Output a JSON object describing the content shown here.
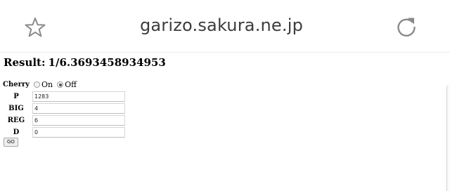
{
  "browser": {
    "url": "garizo.sakura.ne.jp",
    "star_icon": "star-outline-icon",
    "reload_icon": "reload-icon"
  },
  "result": {
    "label": "Result:",
    "value": "1/6.3693458934953"
  },
  "form": {
    "cherry": {
      "label": "Cherry",
      "options": [
        {
          "label": "On",
          "checked": false
        },
        {
          "label": "Off",
          "checked": true
        }
      ]
    },
    "fields": [
      {
        "label": "P",
        "value": "1283"
      },
      {
        "label": "BIG",
        "value": "4"
      },
      {
        "label": "REG",
        "value": "6"
      },
      {
        "label": "D",
        "value": "0"
      }
    ],
    "submit_label": "GO"
  },
  "colors": {
    "url_text": "#3c3c3c",
    "icon_gray": "#8a8a8a"
  }
}
